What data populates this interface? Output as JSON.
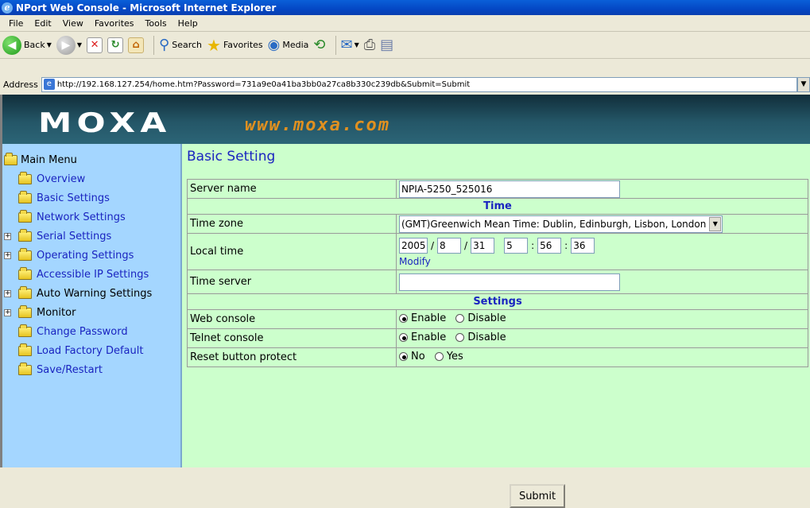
{
  "window": {
    "title": "NPort Web Console - Microsoft Internet Explorer"
  },
  "menu": [
    "File",
    "Edit",
    "View",
    "Favorites",
    "Tools",
    "Help"
  ],
  "toolbar": {
    "back": "Back",
    "search": "Search",
    "favorites": "Favorites",
    "media": "Media"
  },
  "address": {
    "label": "Address",
    "url": "http://192.168.127.254/home.htm?Password=731a9e0a41ba3bb0a27ca8b330c239db&Submit=Submit"
  },
  "banner": {
    "logo": "MOXA",
    "url": "www.moxa.com"
  },
  "sidebar": {
    "root": "Main Menu",
    "items": [
      {
        "label": "Overview",
        "expandable": false
      },
      {
        "label": "Basic Settings",
        "expandable": false
      },
      {
        "label": "Network Settings",
        "expandable": false
      },
      {
        "label": "Serial Settings",
        "expandable": true
      },
      {
        "label": "Operating Settings",
        "expandable": true
      },
      {
        "label": "Accessible IP Settings",
        "expandable": false
      },
      {
        "label": "Auto Warning Settings",
        "expandable": true
      },
      {
        "label": "Monitor",
        "expandable": true
      },
      {
        "label": "Change Password",
        "expandable": false
      },
      {
        "label": "Load Factory Default",
        "expandable": false
      },
      {
        "label": "Save/Restart",
        "expandable": false
      }
    ]
  },
  "content": {
    "heading": "Basic Setting",
    "server_name_label": "Server name",
    "server_name_value": "NPIA-5250_525016",
    "time_section": "Time",
    "time_zone_label": "Time zone",
    "time_zone_value": "(GMT)Greenwich Mean Time: Dublin, Edinburgh, Lisbon, London",
    "local_time_label": "Local time",
    "local_time": {
      "year": "2005",
      "month": "8",
      "day": "31",
      "hour": "5",
      "minute": "56",
      "second": "36"
    },
    "date_sep": "/",
    "time_sep": ":",
    "modify_link": "Modify",
    "time_server_label": "Time server",
    "time_server_value": "",
    "settings_section": "Settings",
    "web_console_label": "Web console",
    "telnet_console_label": "Telnet console",
    "reset_protect_label": "Reset button protect",
    "enable": "Enable",
    "disable": "Disable",
    "no": "No",
    "yes": "Yes",
    "submit": "Submit"
  }
}
